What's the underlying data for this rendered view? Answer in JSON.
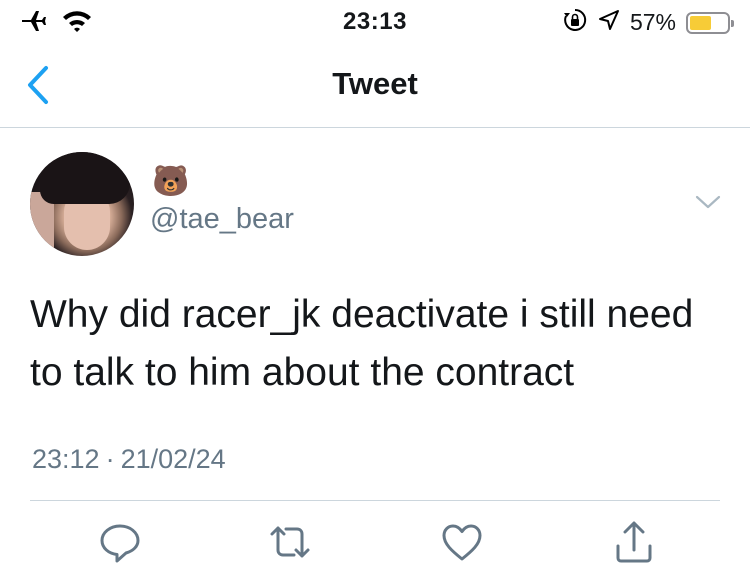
{
  "status_bar": {
    "time": "23:13",
    "battery_percent": "57%",
    "battery_level": 0.57,
    "icons": [
      "airplane-icon",
      "wifi-icon",
      "orientation-lock-icon",
      "location-arrow-icon",
      "battery-icon"
    ]
  },
  "nav": {
    "title": "Tweet",
    "back_icon": "chevron-left-icon"
  },
  "tweet": {
    "display_name": "🐻",
    "handle": "@tae_bear",
    "text": "Why did racer_jk deactivate i still need to talk to him about the contract",
    "time": "23:12",
    "separator": "·",
    "date": "21/02/24",
    "more_icon": "chevron-down-icon"
  },
  "actions": [
    "reply-icon",
    "retweet-icon",
    "like-icon",
    "share-icon"
  ],
  "colors": {
    "accent": "#1da1f2",
    "text": "#14171a",
    "secondary_text": "#657786",
    "divider": "#ccd6dd",
    "battery": "#f7cc37"
  }
}
